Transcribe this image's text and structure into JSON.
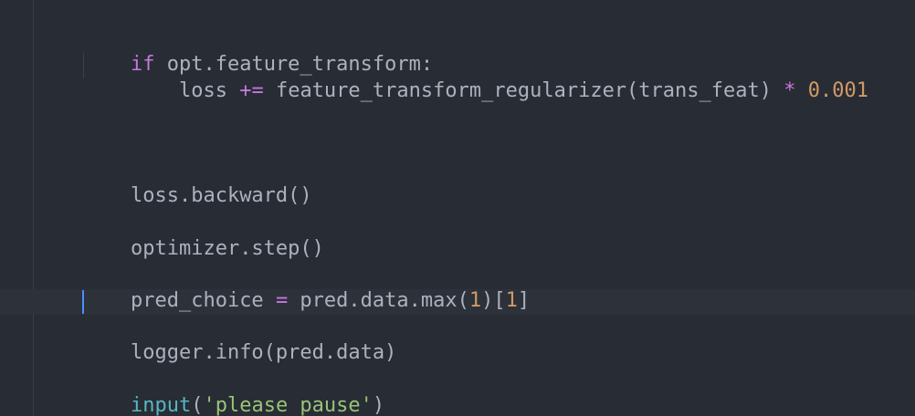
{
  "code": {
    "line1": {
      "keyword": "if",
      "text": " opt.feature_transform:"
    },
    "line2": {
      "indent": "    ",
      "lhs": "loss ",
      "op": "+=",
      "call": " feature_transform_regularizer(trans_feat) ",
      "mul": "*",
      "space": " ",
      "num": "0.001"
    },
    "line3": {
      "text": "loss.backward()"
    },
    "line4": {
      "text": "optimizer.step()"
    },
    "line5": {
      "lhs": "pred_choice ",
      "op": "=",
      "mid": " pred.data.max(",
      "num1": "1",
      "close1": ")[",
      "num2": "1",
      "close2": "]"
    },
    "line6": {
      "text": "logger.info(pred.data)"
    },
    "line7": {
      "fn": "input",
      "open": "(",
      "str": "'please pause'",
      "close": ")"
    }
  },
  "colors": {
    "background": "#282c34",
    "keyword": "#c678dd",
    "number": "#d19a66",
    "string": "#98c379",
    "builtin": "#56b6c2",
    "text": "#abb2bf",
    "cursor": "#528bff"
  }
}
